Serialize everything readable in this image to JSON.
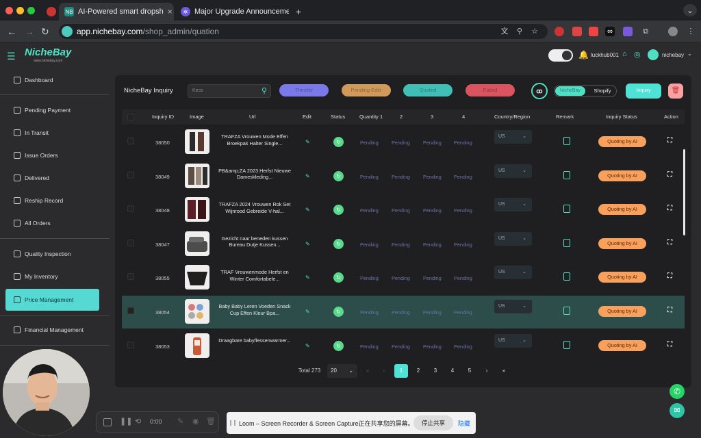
{
  "browser": {
    "tabs": [
      {
        "title": "AI-Powered smart dropsh",
        "active": true
      },
      {
        "title": "Major Upgrade Announcemen",
        "active": false
      }
    ],
    "url_host": "app.nichebay.com",
    "url_path": "/shop_admin/quation"
  },
  "header": {
    "logo": "NicheBay",
    "logo_sub": "www.nichebay.com",
    "user1": "luckhub001",
    "user2": "nichebay"
  },
  "sidebar": {
    "items": [
      {
        "label": "Dashboard"
      },
      {
        "label": "Pending Payment"
      },
      {
        "label": "In Transit"
      },
      {
        "label": "Issue Orders"
      },
      {
        "label": "Delivered"
      },
      {
        "label": "Reship Record"
      },
      {
        "label": "All Orders"
      },
      {
        "label": "Quality Inspection"
      },
      {
        "label": "My Inventory"
      },
      {
        "label": "Price Management"
      },
      {
        "label": "Financial Management"
      }
    ]
  },
  "toolbar": {
    "title": "NicheBay Inquiry",
    "search_placeholder": "Keↄs",
    "filters": [
      "Thesiler",
      "Pending Editr",
      "Quoted",
      "Failed"
    ],
    "toggle_a": "NicheBay",
    "toggle_b": "Shopify",
    "inquiry_label": "Inquiry"
  },
  "table": {
    "headers": [
      "Inquiry ID",
      "Image",
      "Url",
      "Edit",
      "Status",
      "Quantity 1",
      "2",
      "3",
      "4",
      "Country/Region",
      "Remark",
      "Inquiry Status",
      "Action"
    ],
    "rows": [
      {
        "id": "38050",
        "url": "TRAFZA Vrouwen Mode Effen Broekpak Halter Single...",
        "q1": "Pending",
        "q2": "Pending",
        "q3": "Pending",
        "q4": "Pending",
        "country": "US",
        "status": "Quoting by AI"
      },
      {
        "id": "38049",
        "url": "PB&amp;ZA 2023 Herfst Nieuwe Dameskleding...",
        "q1": "Pending",
        "q2": "Pending",
        "q3": "Pending",
        "q4": "Pending",
        "country": "US",
        "status": "Quoting by AI"
      },
      {
        "id": "38048",
        "url": "TRAFZA 2024 Vrouwen Rok Set Wijnrood Gebreide V-hal...",
        "q1": "Pending",
        "q2": "Pending",
        "q3": "Pending",
        "q4": "Pending",
        "country": "US",
        "status": "Quoting by AI"
      },
      {
        "id": "38047",
        "url": "Gezicht naar beneden kussen Bureau Dutje Kussen...",
        "q1": "Pending",
        "q2": "Pending",
        "q3": "Pending",
        "q4": "Pending",
        "country": "US",
        "status": "Quoting by AI"
      },
      {
        "id": "38055",
        "url": "TRAF Vrouwenmode Herfst en Winter Comfortabele...",
        "q1": "Pending",
        "q2": "Pending",
        "q3": "Pending",
        "q4": "Pending",
        "country": "US",
        "status": "Quoting by AI"
      },
      {
        "id": "38054",
        "url": "Baby Baby Leren Voeden Snack Cup Effen Kleur Bpa...",
        "q1": "Pending",
        "q2": "Pending",
        "q3": "Pending",
        "q4": "Pending",
        "country": "US",
        "status": "Quoting by AI"
      },
      {
        "id": "38053",
        "url": "Draagbare babyflessenwarmer...",
        "q1": "Pending",
        "q2": "Pending",
        "q3": "Pending",
        "q4": "Pending",
        "country": "US",
        "status": "Quoting by AI"
      }
    ]
  },
  "pagination": {
    "total": "Total 273",
    "page_size": "20",
    "pages": [
      "1",
      "2",
      "3",
      "4",
      "5"
    ],
    "current": "1"
  },
  "loom": {
    "time": "0:00",
    "message": "Loom – Screen Recorder & Screen Capture正在共享您的屏幕。",
    "stop": "停止共享",
    "hide": "隐藏"
  }
}
